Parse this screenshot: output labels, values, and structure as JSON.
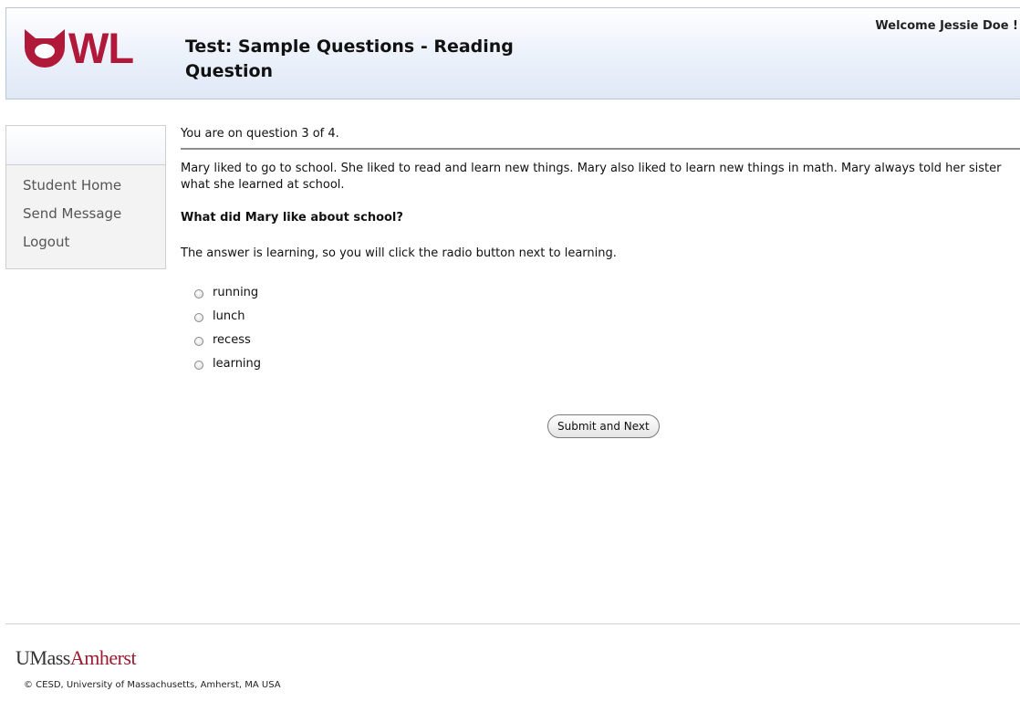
{
  "header": {
    "logo_text": "WL",
    "title": "Test: Sample Questions - Reading Question",
    "welcome": "Welcome Jessie Doe !"
  },
  "sidebar": {
    "items": [
      {
        "label": "Student Home"
      },
      {
        "label": "Send Message"
      },
      {
        "label": "Logout"
      }
    ]
  },
  "main": {
    "progress": "You are on question 3 of 4.",
    "passage": "Mary liked to go to school. She liked to read and learn new things. Mary also liked to learn new things in math. Mary always told her sister what she learned at school.",
    "question": "What did Mary like about school?",
    "instruction": "The answer is learning, so you will click the radio button next to learning.",
    "options": [
      {
        "label": "running"
      },
      {
        "label": "lunch"
      },
      {
        "label": "recess"
      },
      {
        "label": "learning"
      }
    ],
    "submit_label": "Submit and Next"
  },
  "footer": {
    "logo_part1": "UMass",
    "logo_part2": "Amherst",
    "copyright": "© CESD, University of Massachusetts, Amherst, MA USA"
  },
  "colors": {
    "brand": "#b0193a",
    "header_gradient_end": "#dfe8f6",
    "umass_red": "#9b1b30"
  },
  "icons": {
    "logo_mark": "owl-logo-icon",
    "radio": "radio-unselected-icon"
  }
}
